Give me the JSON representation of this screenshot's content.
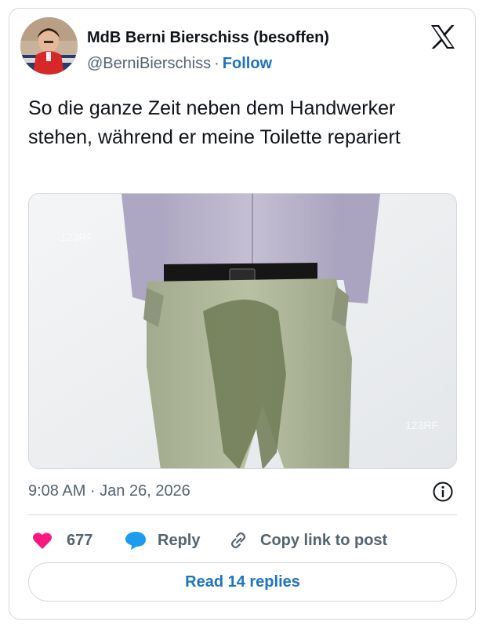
{
  "tweet": {
    "display_name": "MdB Berni Bierschiss (besoffen)",
    "handle": "@BerniBierschiss",
    "separator": "·",
    "follow_label": "Follow",
    "text": "So die ganze Zeit neben dem Handwerker stehen, während er meine Toilette repariert",
    "timestamp": "9:08 AM · Jan 26, 2026"
  },
  "actions": {
    "like_count": "677",
    "reply_label": "Reply",
    "copy_link_label": "Copy link to post"
  },
  "read_replies_label": "Read 14 replies",
  "colors": {
    "accent": "#1d72c4",
    "like": "#f91880",
    "secondary_text": "#536471",
    "border": "#cfd9de"
  },
  "icons": [
    "x-logo-icon",
    "info-icon",
    "heart-icon",
    "reply-bubble-icon",
    "link-icon"
  ]
}
